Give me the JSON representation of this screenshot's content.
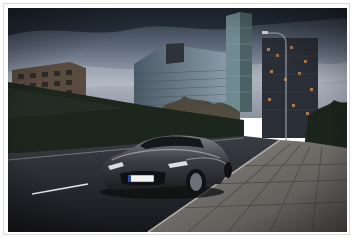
{
  "image": {
    "subject": "car-photo",
    "plate_text": "EL·MX 529"
  },
  "colors": {
    "frame": "#ffffff",
    "frame_border": "#d9d9d9",
    "sky_top": "#2b3441",
    "sky_mid": "#6b7688",
    "sky_light": "#c8ccd6",
    "building_dark": "#2a2f38",
    "hedge": "#1f2a22",
    "road": "#2a2d33",
    "sidewalk": "#6c6a67",
    "car_body": "#3b3d42",
    "car_highlight": "#8e9097"
  }
}
